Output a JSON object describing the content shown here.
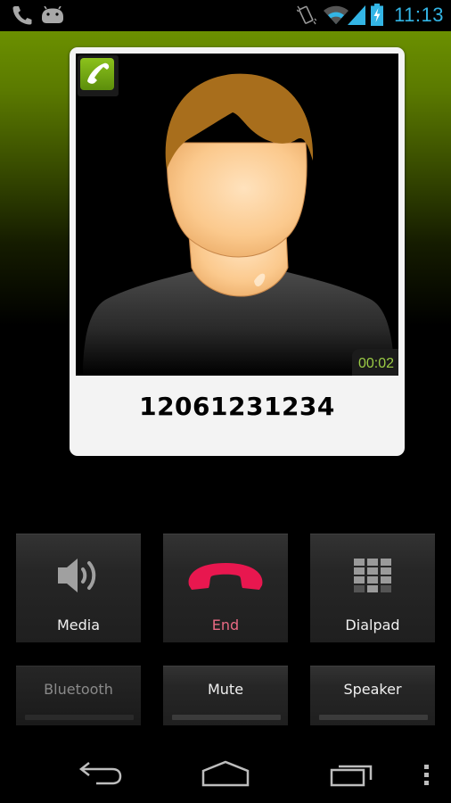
{
  "status_bar": {
    "left_icons": [
      "phone-call-icon",
      "android-debug-icon"
    ],
    "right_icons": [
      "vibrate-icon",
      "wifi-icon",
      "cell-signal-icon",
      "battery-charging-icon"
    ],
    "time": "11:13",
    "accent_color": "#33b5e5"
  },
  "call_card": {
    "status_icon": "active-call-icon",
    "contact_photo": "default-avatar",
    "duration": "00:02",
    "phone_number": "12061231234"
  },
  "actions": {
    "primary": [
      {
        "id": "media",
        "label": "Media",
        "icon": "speaker-volume-icon"
      },
      {
        "id": "end",
        "label": "End",
        "icon": "end-call-icon",
        "color": "#e8174f",
        "label_color": "#e96a84"
      },
      {
        "id": "dialpad",
        "label": "Dialpad",
        "icon": "dialpad-icon"
      }
    ],
    "toggles": [
      {
        "id": "bluetooth",
        "label": "Bluetooth",
        "enabled": false,
        "on": false
      },
      {
        "id": "mute",
        "label": "Mute",
        "enabled": true,
        "on": false
      },
      {
        "id": "speaker",
        "label": "Speaker",
        "enabled": true,
        "on": false
      }
    ]
  },
  "nav_bar": {
    "buttons": [
      "back-icon",
      "home-icon",
      "recent-apps-icon",
      "overflow-menu-icon"
    ]
  }
}
